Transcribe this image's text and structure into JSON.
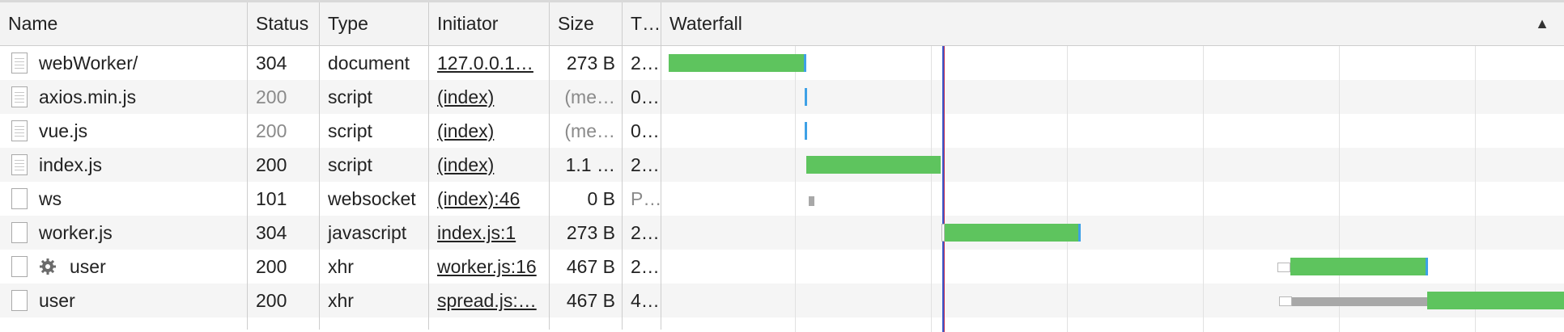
{
  "columns": {
    "name": "Name",
    "status": "Status",
    "type": "Type",
    "initiator": "Initiator",
    "size": "Size",
    "time": "T…",
    "waterfall": "Waterfall",
    "sort_indicator": "▲"
  },
  "rows": [
    {
      "name": "webWorker/",
      "icon": "document-file-icon",
      "status": "304",
      "type": "document",
      "initiator": "127.0.0.1…",
      "size": "273 B",
      "time": "2…",
      "status_gray": false,
      "size_gray": false
    },
    {
      "name": "axios.min.js",
      "icon": "document-file-icon",
      "status": "200",
      "type": "script",
      "initiator": "(index)",
      "size": "(me…",
      "time": "0…",
      "status_gray": true,
      "size_gray": true
    },
    {
      "name": "vue.js",
      "icon": "document-file-icon",
      "status": "200",
      "type": "script",
      "initiator": "(index)",
      "size": "(me…",
      "time": "0…",
      "status_gray": true,
      "size_gray": true
    },
    {
      "name": "index.js",
      "icon": "document-file-icon",
      "status": "200",
      "type": "script",
      "initiator": "(index)",
      "size": "1.1 …",
      "time": "2…",
      "status_gray": false,
      "size_gray": false
    },
    {
      "name": "ws",
      "icon": "blank-file-icon",
      "status": "101",
      "type": "websocket",
      "initiator": "(index):46",
      "size": "0 B",
      "time": "P…",
      "status_gray": false,
      "size_gray": false,
      "time_gray": true
    },
    {
      "name": "worker.js",
      "icon": "blank-file-icon",
      "status": "304",
      "type": "javascript",
      "initiator": "index.js:1",
      "size": "273 B",
      "time": "2…",
      "status_gray": false,
      "size_gray": false
    },
    {
      "name": "user",
      "icon": "blank-file-icon",
      "gear": true,
      "status": "200",
      "type": "xhr",
      "initiator": "worker.js:16",
      "size": "467 B",
      "time": "2…",
      "status_gray": false,
      "size_gray": false
    },
    {
      "name": "user",
      "icon": "blank-file-icon",
      "status": "200",
      "type": "xhr",
      "initiator": "spread.js:…",
      "size": "467 B",
      "time": "4…",
      "status_gray": false,
      "size_gray": false
    }
  ],
  "colors": {
    "receiving": "#5ec45e",
    "queued": "#a8a8a8",
    "dom_content_loaded": "#3a57c9",
    "load": "#c1375c",
    "tick": "#3ea1e6"
  }
}
